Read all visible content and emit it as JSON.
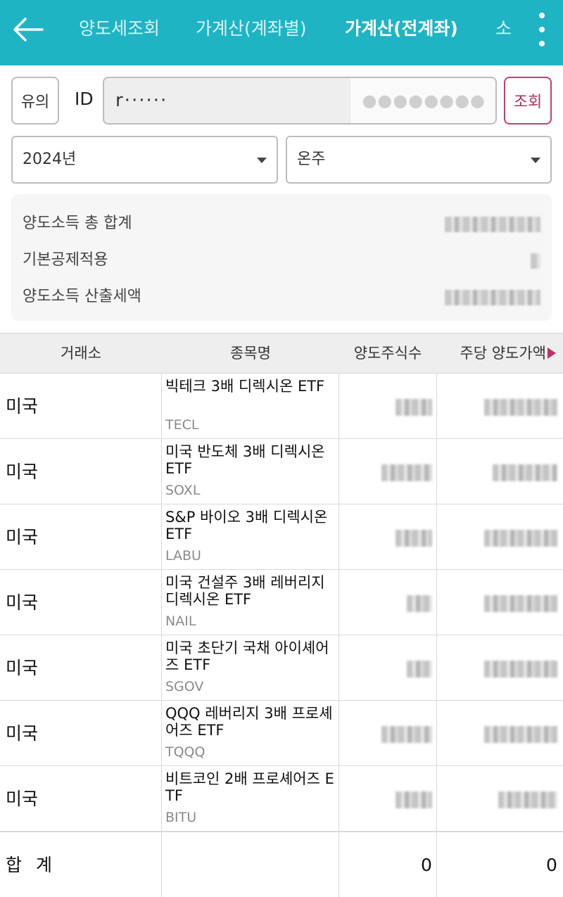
{
  "header": {
    "tabs": [
      {
        "label": "양도세조회",
        "active": false
      },
      {
        "label": "가계산(계좌별)",
        "active": false
      },
      {
        "label": "가계산(전계좌)",
        "active": true
      },
      {
        "label": "소",
        "active": false
      }
    ],
    "bg_color": "#1fb4c4"
  },
  "search": {
    "notice_label": "유의",
    "id_label": "ID",
    "id_value": "r······",
    "password_mask": "●●●●●●●●",
    "query_label": "조회"
  },
  "filters": {
    "year": "2024년",
    "category": "온주"
  },
  "summary": {
    "items": [
      {
        "label": "양도소득 총 합계"
      },
      {
        "label": "기본공제적용"
      },
      {
        "label": "양도소득 산출세액"
      }
    ]
  },
  "table": {
    "headers": [
      "거래소",
      "종목명",
      "양도주식수",
      "주당 양도가액"
    ],
    "rows": [
      {
        "exchange": "미국",
        "name": "빅테크 3배 디렉시온 ETF",
        "code": "TECL"
      },
      {
        "exchange": "미국",
        "name": "미국 반도체 3배 디렉시온 ETF",
        "code": "SOXL"
      },
      {
        "exchange": "미국",
        "name": "S&P 바이오 3배 디렉시온 ETF",
        "code": "LABU"
      },
      {
        "exchange": "미국",
        "name": "미국 건설주 3배 레버리지 디렉시온 ETF",
        "code": "NAIL"
      },
      {
        "exchange": "미국",
        "name": "미국 초단기 국채 아이셰어즈 ETF",
        "code": "SGOV"
      },
      {
        "exchange": "미국",
        "name": "QQQ 레버리지 3배 프로셰어즈 ETF",
        "code": "TQQQ"
      },
      {
        "exchange": "미국",
        "name": "비트코인 2배 프로셰어즈 ETF",
        "code": "BITU"
      }
    ],
    "total": {
      "label": "합 계",
      "shares": "0",
      "price": "0"
    }
  },
  "colors": {
    "accent": "#1fb4c4",
    "query_button": "#c0406a"
  }
}
